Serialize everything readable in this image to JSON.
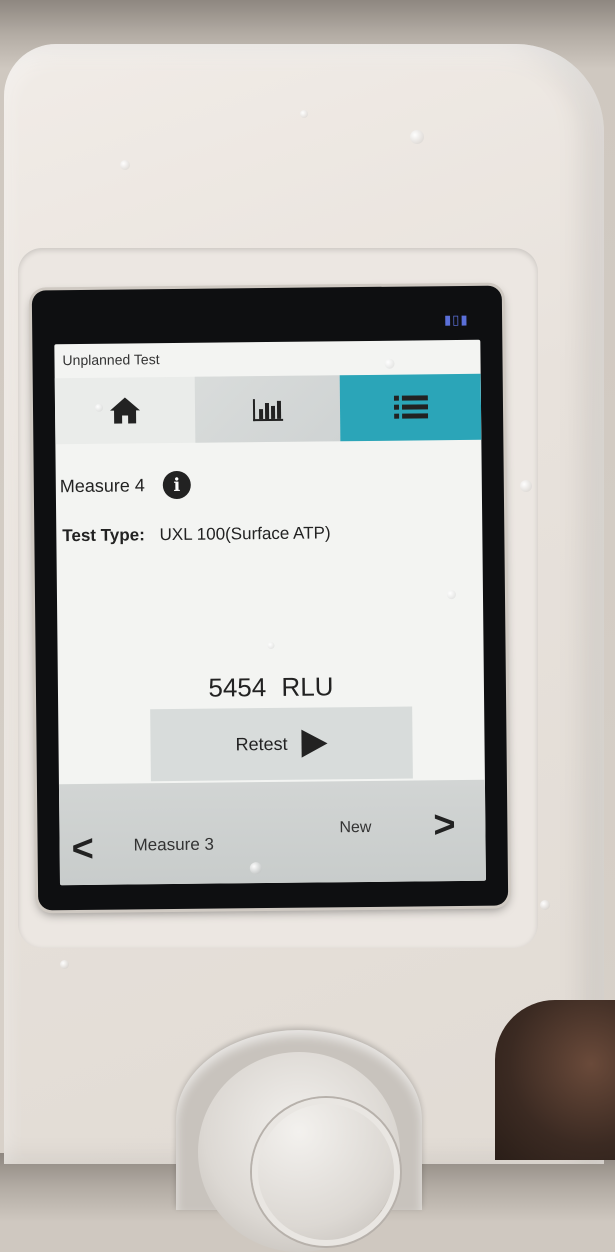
{
  "screen": {
    "title": "Unplanned Test",
    "measure_label": "Measure 4",
    "test_type_label": "Test Type:",
    "test_type_value": "UXL 100(Surface ATP)",
    "result_value": "5454",
    "result_unit": "RLU",
    "retest_label": "Retest",
    "prev_label": "Measure 3",
    "next_label": "New"
  },
  "toolbar": {
    "tabs": [
      {
        "icon": "home-icon"
      },
      {
        "icon": "bar-chart-icon"
      },
      {
        "icon": "list-icon",
        "active": true
      }
    ],
    "active_color": "#2ba5b8"
  }
}
